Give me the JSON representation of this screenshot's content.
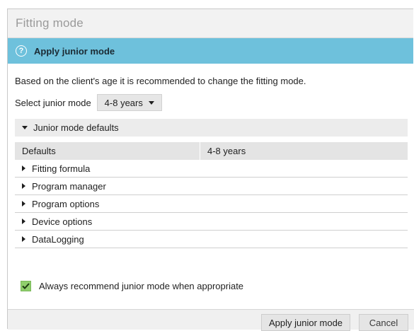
{
  "dialog": {
    "title": "Fitting mode",
    "banner": {
      "icon": "help-icon",
      "icon_glyph": "?",
      "text": "Apply junior mode"
    },
    "description": "Based on the client's age it is recommended to change the fitting mode.",
    "select": {
      "label": "Select junior mode",
      "value": "4-8 years"
    },
    "defaults_section": {
      "label": "Junior mode defaults",
      "table_headers": [
        "Defaults",
        "4-8 years"
      ],
      "rows": [
        "Fitting formula",
        "Program manager",
        "Program options",
        "Device options",
        "DataLogging"
      ]
    },
    "checkbox": {
      "label": "Always recommend junior mode when appropriate",
      "checked": true,
      "color": "#8fcf6c"
    },
    "buttons": {
      "apply": "Apply junior mode",
      "cancel": "Cancel"
    },
    "colors": {
      "banner": "#6ec1dc"
    }
  }
}
